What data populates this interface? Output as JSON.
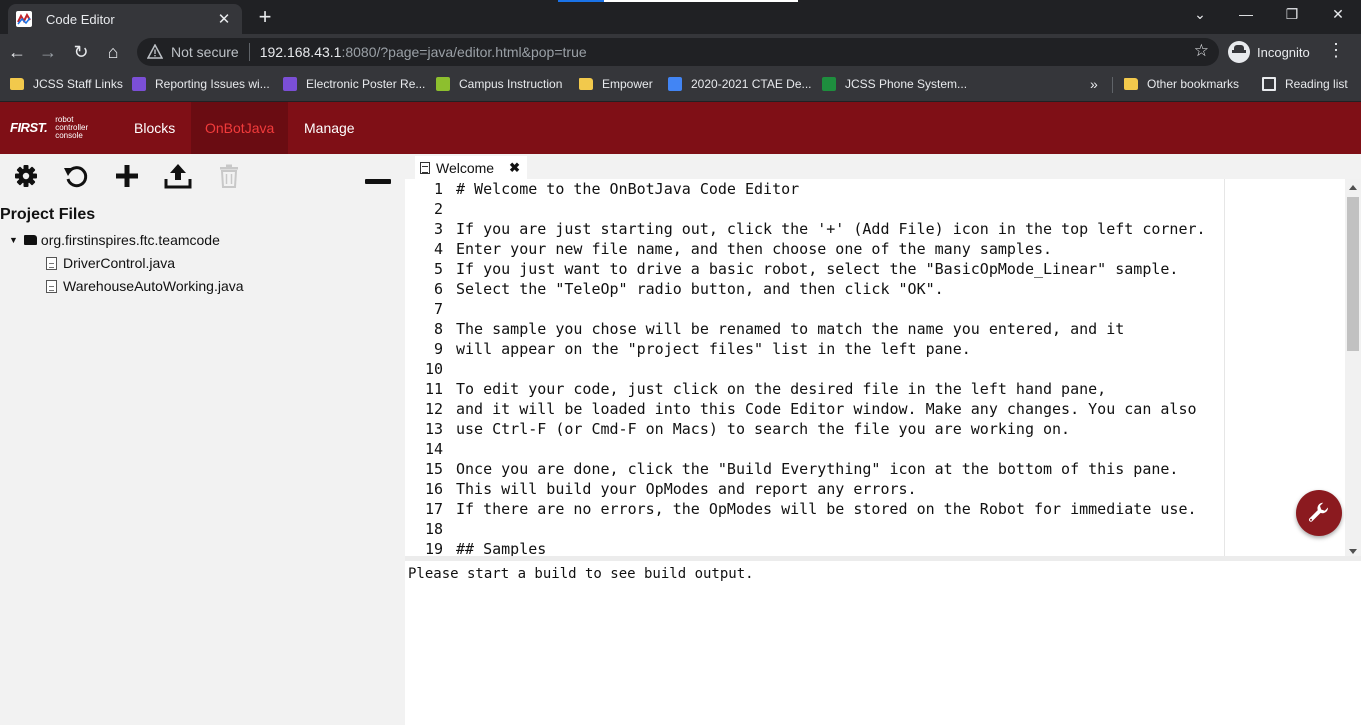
{
  "browser": {
    "tab_title": "Code Editor",
    "tab_close": "✕",
    "new_tab": "+",
    "window_controls": [
      "⌄",
      "—",
      "❐",
      "✕"
    ],
    "nav": {
      "back": "←",
      "forward": "→",
      "reload": "↻",
      "home": "⌂"
    },
    "security_label": "Not secure",
    "url_host": "192.168.43.1",
    "url_rest": ":8080/?page=java/editor.html&pop=true",
    "star": "☆",
    "profile_label": "Incognito",
    "menu": "⋮",
    "bookmarks": [
      {
        "label": "JCSS Staff Links",
        "icon": "folder"
      },
      {
        "label": "Reporting Issues wi...",
        "icon": "purple"
      },
      {
        "label": "Electronic Poster Re...",
        "icon": "purple"
      },
      {
        "label": "Campus Instruction",
        "icon": "green"
      },
      {
        "label": "Empower",
        "icon": "folder"
      },
      {
        "label": "2020-2021 CTAE De...",
        "icon": "blue"
      },
      {
        "label": "JCSS Phone System...",
        "icon": "teal"
      }
    ],
    "bookmarks_more": "»",
    "other_bookmarks": "Other bookmarks",
    "reading_list": "Reading list"
  },
  "app": {
    "brand_first": "FIRST.",
    "brand_line1": "robot",
    "brand_line2": "controller",
    "brand_line3": "console",
    "nav": [
      "Blocks",
      "OnBotJava",
      "Manage"
    ],
    "active_nav": "OnBotJava",
    "accent_color": "#7f0f16"
  },
  "project": {
    "title": "Project Files",
    "root_folder": "org.firstinspires.ftc.teamcode",
    "files": [
      "DriverControl.java",
      "WarehouseAutoWorking.java"
    ]
  },
  "editor": {
    "tab_label": "Welcome",
    "tab_close": "✖",
    "line_numbers": [
      "1",
      "2",
      "3",
      "4",
      "5",
      "6",
      "7",
      "8",
      "9",
      "10",
      "11",
      "12",
      "13",
      "14",
      "15",
      "16",
      "17",
      "18",
      "19"
    ],
    "lines": [
      "# Welcome to the OnBotJava Code Editor",
      "",
      "If you are just starting out, click the '+' (Add File) icon in the top left corner.",
      "Enter your new file name, and then choose one of the many samples.",
      "If you just want to drive a basic robot, select the \"BasicOpMode_Linear\" sample.",
      "Select the \"TeleOp\" radio button, and then click \"OK\".",
      "",
      "The sample you chose will be renamed to match the name you entered, and it",
      "will appear on the \"project files\" list in the left pane.",
      "",
      "To edit your code, just click on the desired file in the left hand pane,",
      "and it will be loaded into this Code Editor window. Make any changes. You can also",
      "use Ctrl-F (or Cmd-F on Macs) to search the file you are working on.",
      "",
      "Once you are done, click the \"Build Everything\" icon at the bottom of this pane.",
      "This will build your OpModes and report any errors.",
      "If there are no errors, the OpModes will be stored on the Robot for immediate use.",
      "",
      "## Samples"
    ]
  },
  "build_output": "Please start a build to see build output."
}
